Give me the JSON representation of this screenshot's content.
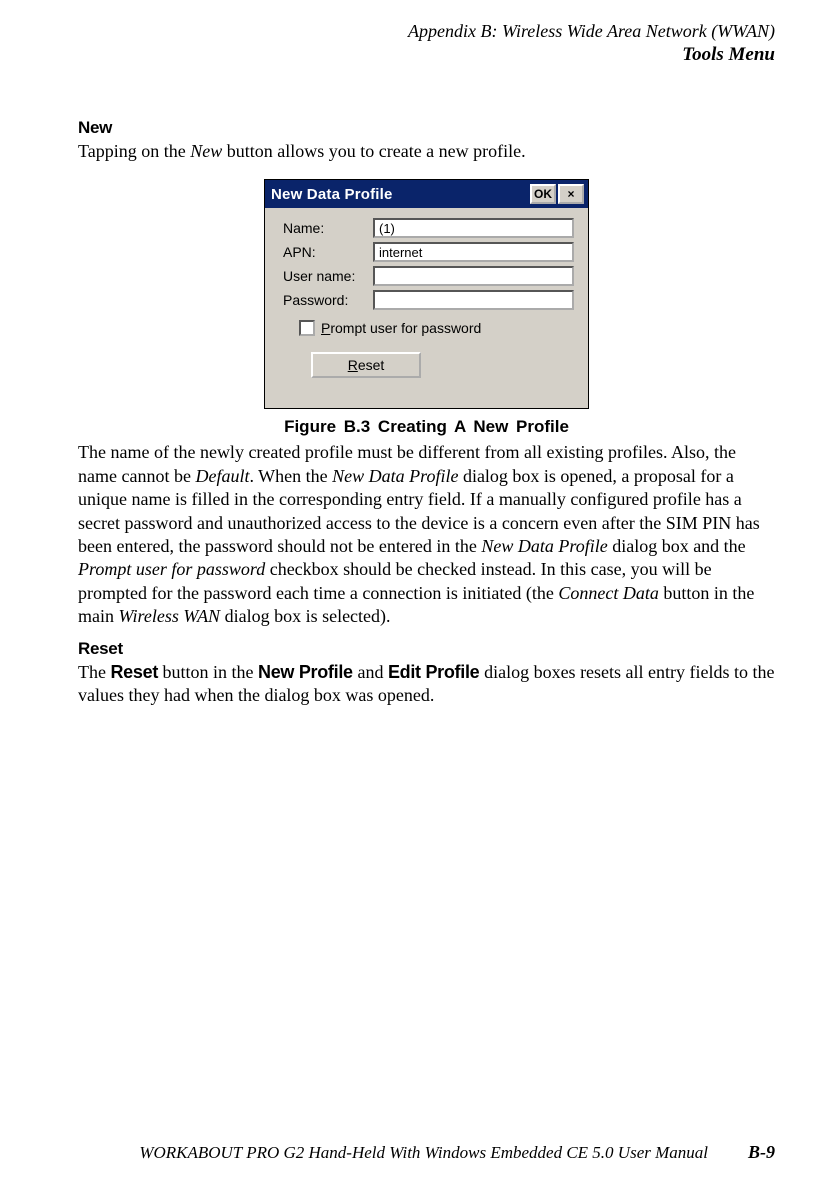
{
  "header": {
    "appendix": "Appendix  B:  Wireless Wide Area Network (WWAN)",
    "tools": "Tools Menu"
  },
  "section_new": {
    "heading": "New",
    "intro_before": "Tapping on the ",
    "intro_ital": "New",
    "intro_after": " button allows you to create a new profile."
  },
  "dialog": {
    "title": "New Data Profile",
    "ok_label": "OK",
    "close_symbol": "×",
    "labels": {
      "name": "Name:",
      "apn": "APN:",
      "user": "User name:",
      "password": "Password:"
    },
    "values": {
      "name": "(1)",
      "apn": "internet",
      "user": "",
      "password": ""
    },
    "checkbox_underline": "P",
    "checkbox_rest": "rompt user for password",
    "reset_underline": "R",
    "reset_rest": "eset"
  },
  "figure_caption": "Figure  B.3    Creating  A  New  Profile",
  "para1": {
    "t1": "The name of the newly created profile must be different from all existing profiles. Also, the name cannot be ",
    "i1": "Default",
    "t2": ". When the ",
    "i2": "New Data Profile",
    "t3": " dialog box is opened, a proposal for a unique name is filled in the corresponding entry field. If a manually configured profile has a secret password and unauthorized access to the device is a concern even after the SIM PIN has been entered, the password should not be entered in the ",
    "i3": "New Data Profile",
    "t4": " dialog box and the ",
    "i4": "Prompt user for password",
    "t5": " checkbox should be checked instead. In this case, you will be prompted for the password each time a connection is initiated (the ",
    "i5": "Connect Data",
    "t6": " button in the main ",
    "i6": " Wireless WAN ",
    "t7": " dialog box is selected)."
  },
  "section_reset": {
    "heading": "Reset",
    "t1": "The ",
    "b1": "Reset",
    "t2": " button in the ",
    "b2": "New  Profile ",
    "t3": " and ",
    "b3": "Edit  Profile ",
    "t4": " dialog boxes resets all entry fields to the values they had when the dialog box was opened."
  },
  "footer": {
    "main": "WORKABOUT PRO G2 Hand-Held With Windows Embedded CE 5.0 User Manual",
    "page": "B-9"
  }
}
